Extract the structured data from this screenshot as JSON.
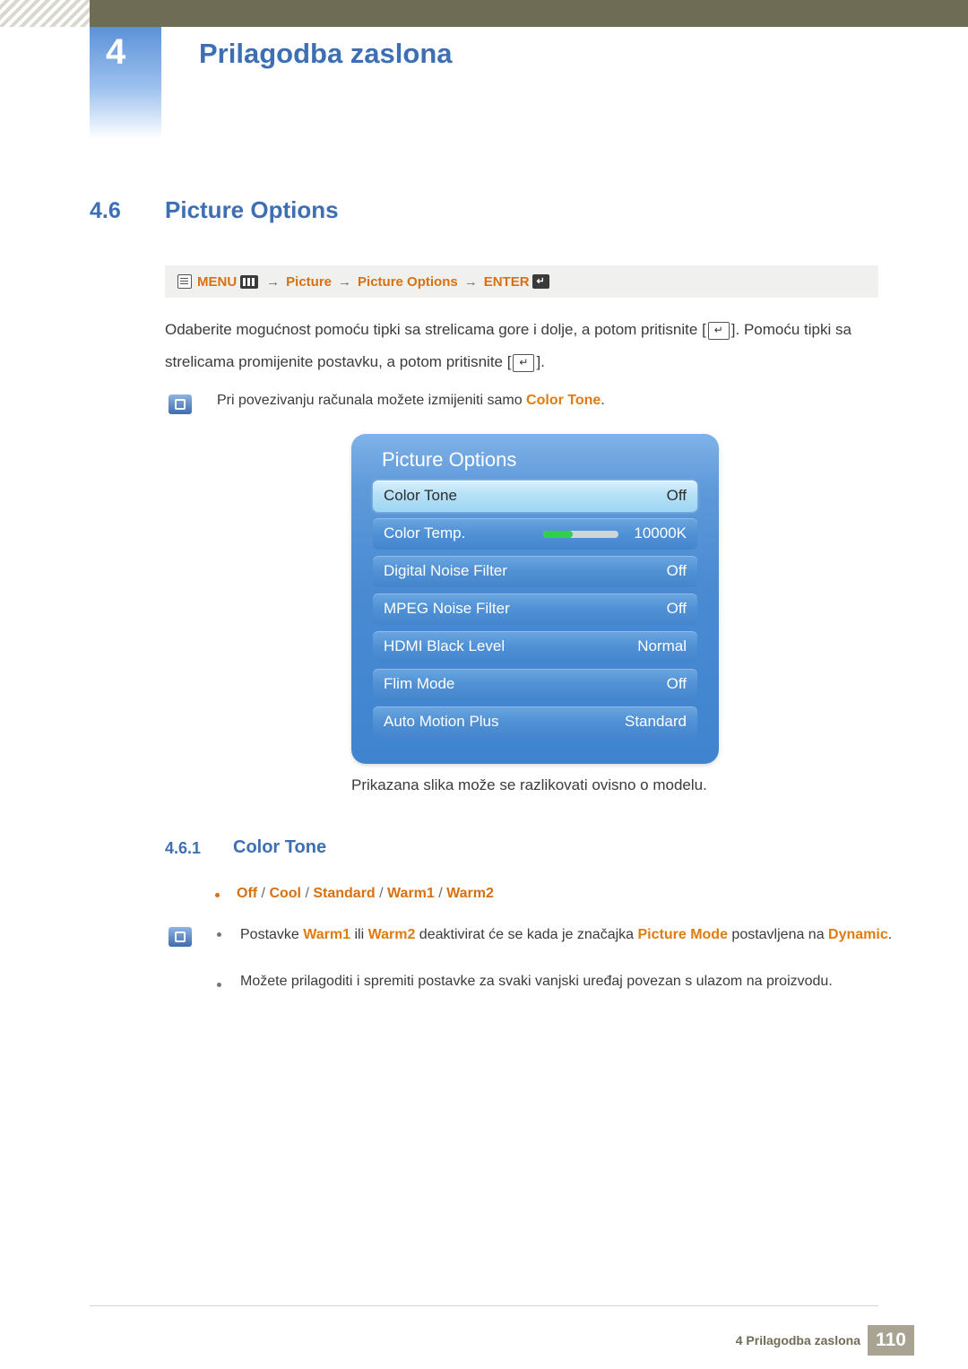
{
  "header": {
    "chapter_number": "4",
    "chapter_title": "Prilagodba zaslona"
  },
  "section": {
    "number": "4.6",
    "title": "Picture Options"
  },
  "menu_path": {
    "menu_label": "MENU",
    "arrow1": "→",
    "item1": "Picture",
    "arrow2": "→",
    "item2": "Picture Options",
    "arrow3": "→",
    "enter_label": "ENTER"
  },
  "paragraph": {
    "part1": "Odaberite mogućnost pomoću tipki sa strelicama gore i dolje, a potom pritisnite [",
    "part2": "]. Pomoću tipki sa strelicama promijenite postavku, a potom pritisnite [",
    "part3": "]."
  },
  "note_top": {
    "text_before": "Pri povezivanju računala možete izmijeniti samo ",
    "highlight": "Color Tone",
    "text_after": "."
  },
  "osd": {
    "title": "Picture Options",
    "rows": [
      {
        "label": "Color Tone",
        "value": "Off",
        "selected": true,
        "slider": false
      },
      {
        "label": "Color Temp.",
        "value": "10000K",
        "selected": false,
        "slider": true
      },
      {
        "label": "Digital Noise Filter",
        "value": "Off",
        "selected": false,
        "slider": false
      },
      {
        "label": "MPEG Noise Filter",
        "value": "Off",
        "selected": false,
        "slider": false
      },
      {
        "label": "HDMI Black Level",
        "value": "Normal",
        "selected": false,
        "slider": false
      },
      {
        "label": "Flim Mode",
        "value": "Off",
        "selected": false,
        "slider": false
      },
      {
        "label": "Auto Motion Plus",
        "value": "Standard",
        "selected": false,
        "slider": false
      }
    ],
    "caption": "Prikazana slika može se razlikovati ovisno o modelu."
  },
  "subsection": {
    "number": "4.6.1",
    "title": "Color Tone"
  },
  "options_line": {
    "items": [
      "Off",
      "Cool",
      "Standard",
      "Warm1",
      "Warm2"
    ],
    "separator": " / "
  },
  "note_warm": {
    "p1": "Postavke ",
    "b1": "Warm1",
    "p2": " ili ",
    "b2": "Warm2",
    "p3": " deaktivirat će se kada je značajka ",
    "b3": "Picture Mode",
    "p4": " postavljena na ",
    "b4": "Dynamic",
    "p5": "."
  },
  "note_save": {
    "text": "Možete prilagoditi i spremiti postavke za svaki vanjski uređaj povezan s ulazom na proizvodu."
  },
  "footer": {
    "text": "4 Prilagodba zaslona",
    "page": "110"
  },
  "colors": {
    "accent_blue": "#3d6fb5",
    "accent_orange": "#d9700f",
    "header_band": "#6f6c56",
    "osd_blue": "#4a8bd2",
    "slider_green": "#2fd14a"
  }
}
